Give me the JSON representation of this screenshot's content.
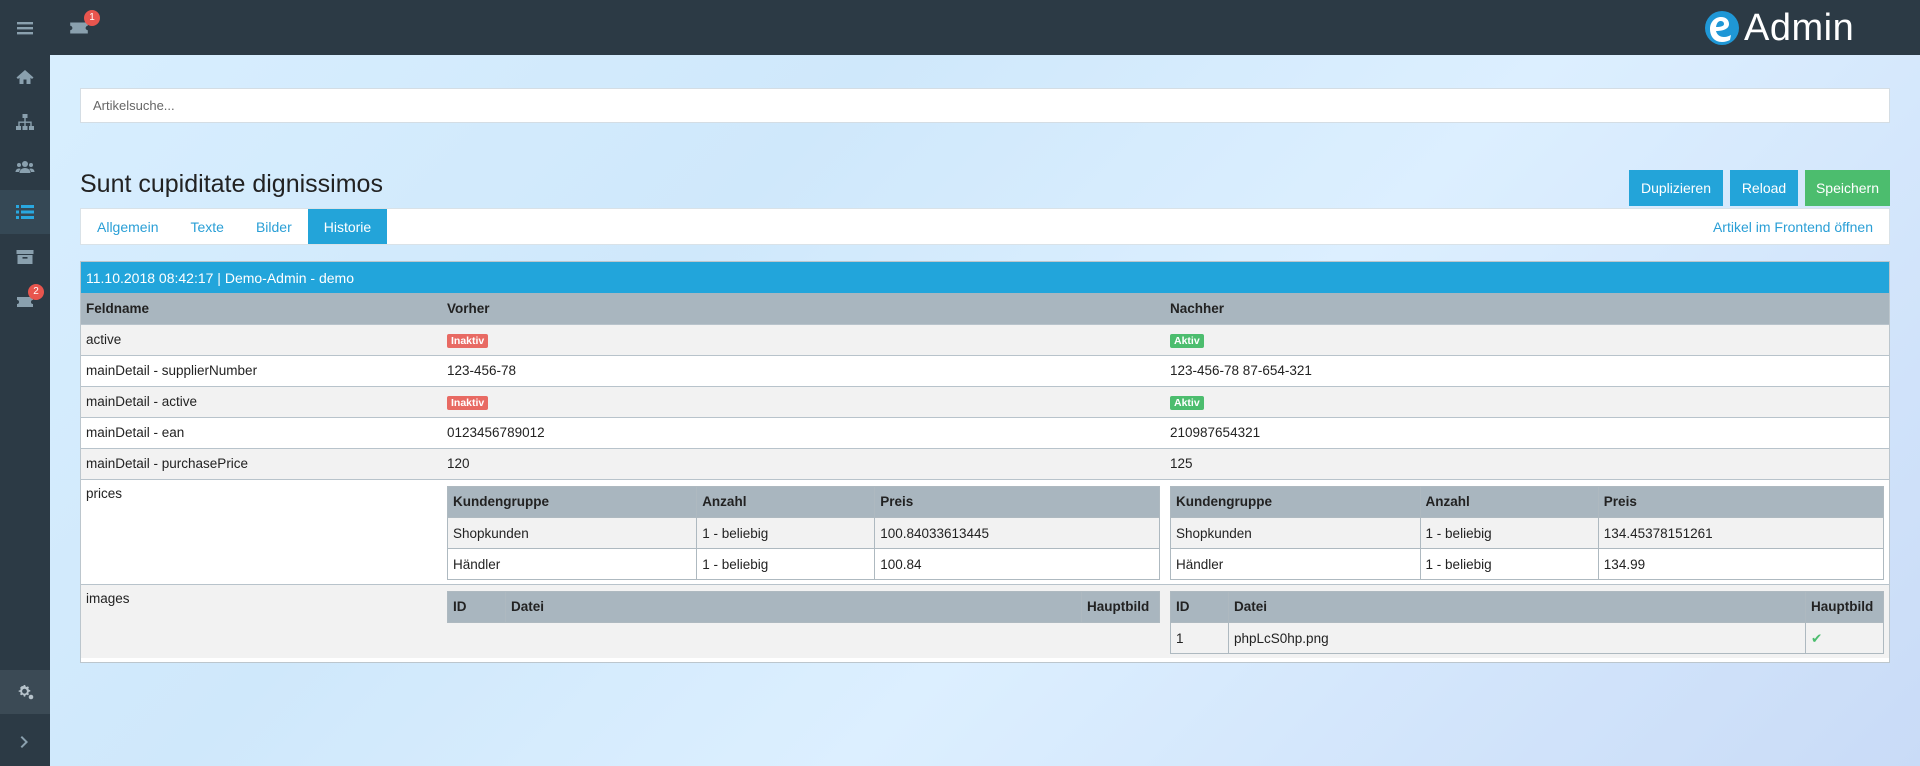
{
  "sidebar": {
    "badge_count": "2"
  },
  "topbar": {
    "badge_count": "1",
    "brand": "Admin"
  },
  "search": {
    "placeholder": "Artikelsuche..."
  },
  "page": {
    "title": "Sunt cupiditate dignissimos",
    "buttons": {
      "duplicate": "Duplizieren",
      "reload": "Reload",
      "save": "Speichern"
    }
  },
  "tabs": {
    "items": [
      "Allgemein",
      "Texte",
      "Bilder",
      "Historie"
    ],
    "active": "Historie",
    "frontend_link": "Artikel im Frontend öffnen"
  },
  "history": {
    "header": "11.10.2018 08:42:17 | Demo-Admin - demo",
    "columns": {
      "field": "Feldname",
      "before": "Vorher",
      "after": "Nachher"
    },
    "rows": [
      {
        "field": "active",
        "before": "Inaktiv",
        "after": "Aktiv"
      },
      {
        "field": "mainDetail - supplierNumber",
        "before": "123-456-78",
        "after": "123-456-78 87-654-321"
      },
      {
        "field": "mainDetail - active",
        "before": "Inaktiv",
        "after": "Aktiv"
      },
      {
        "field": "mainDetail - ean",
        "before": "0123456789012",
        "after": "210987654321"
      },
      {
        "field": "mainDetail - purchasePrice",
        "before": "120",
        "after": "125"
      }
    ],
    "prices": {
      "field": "prices",
      "headers": {
        "group": "Kundengruppe",
        "qty": "Anzahl",
        "price": "Preis"
      },
      "before": [
        {
          "group": "Shopkunden",
          "qty": "1 - beliebig",
          "price": "100.84033613445"
        },
        {
          "group": "Händler",
          "qty": "1 - beliebig",
          "price": "100.84"
        }
      ],
      "after": [
        {
          "group": "Shopkunden",
          "qty": "1 - beliebig",
          "price": "134.45378151261"
        },
        {
          "group": "Händler",
          "qty": "1 - beliebig",
          "price": "134.99"
        }
      ]
    },
    "images": {
      "field": "images",
      "headers": {
        "id": "ID",
        "file": "Datei",
        "main": "Hauptbild"
      },
      "after": [
        {
          "id": "1",
          "file": "phpLcS0hp.png",
          "main": "✔"
        }
      ]
    }
  },
  "colors": {
    "accent": "#23a4d9",
    "success": "#4cbd6e",
    "danger": "#e86a63",
    "sidebar": "#2c3a45"
  }
}
